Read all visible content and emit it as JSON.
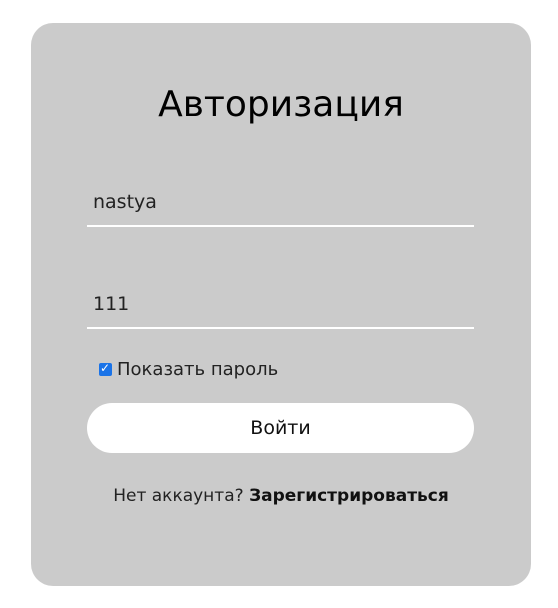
{
  "form": {
    "title": "Авторизация",
    "login_value": "nastya",
    "password_value": "111",
    "show_password_label": "Показать пароль",
    "show_password_checked": true,
    "submit_label": "Войти",
    "no_account_text": "Нет аккаунта?",
    "register_link": "Зарегистрироваться"
  },
  "colors": {
    "card_background": "#cbcbcb",
    "button_background": "#ffffff",
    "checkbox_accent": "#1a73e8"
  },
  "icons": {
    "checkbox": "checkmark-icon"
  }
}
